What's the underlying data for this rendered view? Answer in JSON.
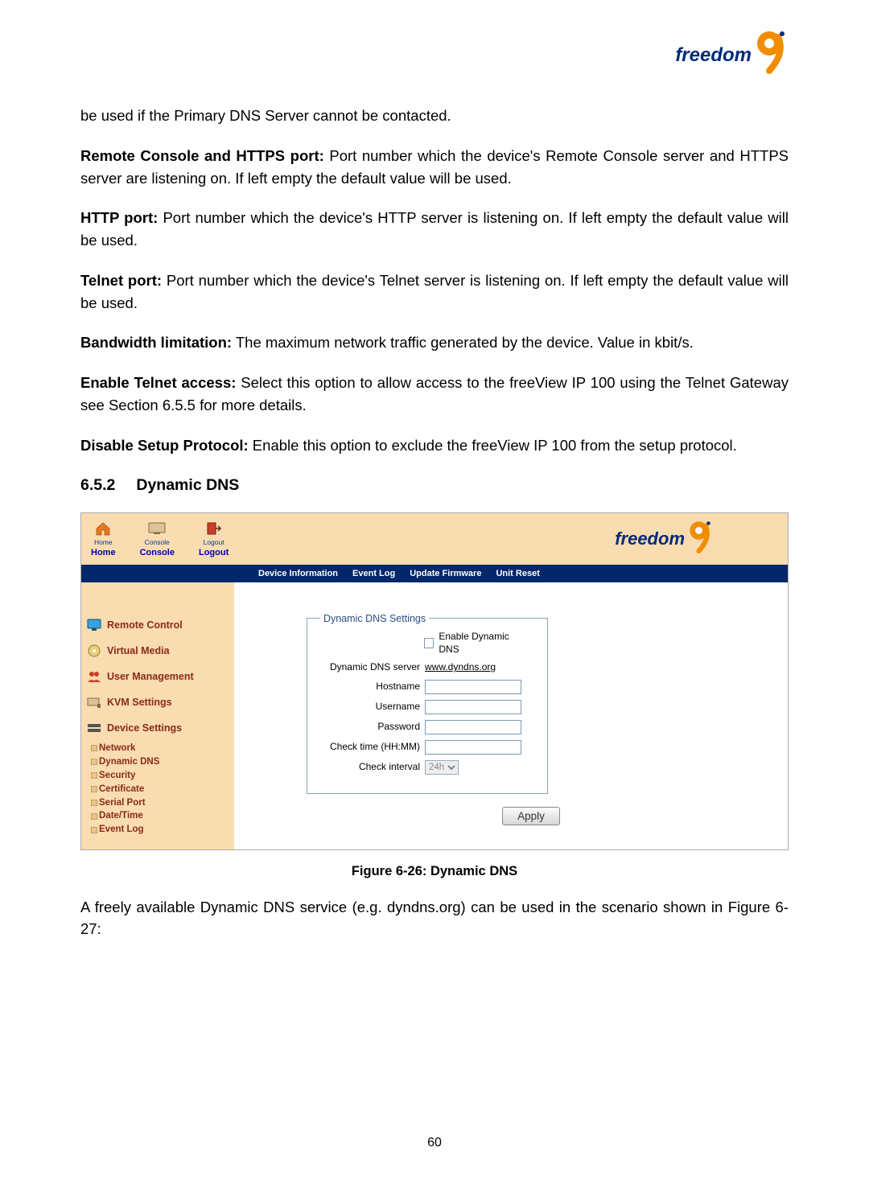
{
  "logo_text": "freedom",
  "paragraphs": {
    "p1": "be used if the Primary DNS Server cannot be contacted.",
    "p2_label": "Remote Console and HTTPS port:",
    "p2_text": " Port number which the device's Remote Console server and HTTPS server are listening on. If left empty the default value will be used.",
    "p3_label": "HTTP port:",
    "p3_text": " Port number which the device's HTTP server is listening on. If left empty the default value will be used.",
    "p4_label": "Telnet port:",
    "p4_text": " Port number which the device's Telnet server is listening on. If left empty the default value will be used.",
    "p5_label": "Bandwidth limitation:",
    "p5_text": " The maximum network traffic generated by the device. Value in kbit/s.",
    "p6_label": "Enable Telnet access:",
    "p6_text": " Select this option to allow access to the freeView IP 100 using the Telnet Gateway see Section 6.5.5 for more details.",
    "p7_label": "Disable Setup Protocol:",
    "p7_text": " Enable this option to exclude the freeView IP 100 from the setup protocol."
  },
  "section": {
    "number": "6.5.2",
    "title": "Dynamic DNS"
  },
  "app": {
    "nav": {
      "home_small": "Home",
      "console_small": "Console",
      "logout_small": "Logout",
      "home": "Home",
      "console": "Console",
      "logout": "Logout"
    },
    "tabs": {
      "device_info": "Device Information",
      "event_log": "Event Log",
      "update_firmware": "Update Firmware",
      "unit_reset": "Unit Reset"
    },
    "sidebar": {
      "remote_control": "Remote Control",
      "virtual_media": "Virtual Media",
      "user_management": "User Management",
      "kvm_settings": "KVM Settings",
      "device_settings": "Device Settings",
      "sub": {
        "network": "Network",
        "dynamic_dns": "Dynamic DNS",
        "security": "Security",
        "certificate": "Certificate",
        "serial_port": "Serial Port",
        "date_time": "Date/Time",
        "event_log": "Event Log"
      }
    },
    "form": {
      "legend": "Dynamic DNS Settings",
      "enable_label": "Enable Dynamic DNS",
      "server_label": "Dynamic DNS server",
      "server_link": "www.dyndns.org",
      "hostname_label": "Hostname",
      "username_label": "Username",
      "password_label": "Password",
      "check_time_label": "Check time (HH:MM)",
      "check_interval_label": "Check interval",
      "check_interval_value": "24h",
      "apply": "Apply"
    }
  },
  "figure_caption": "Figure 6-26: Dynamic DNS",
  "after_figure": "A freely available Dynamic DNS service (e.g. dyndns.org) can be used in the scenario shown in Figure 6-27:",
  "page_number": "60"
}
